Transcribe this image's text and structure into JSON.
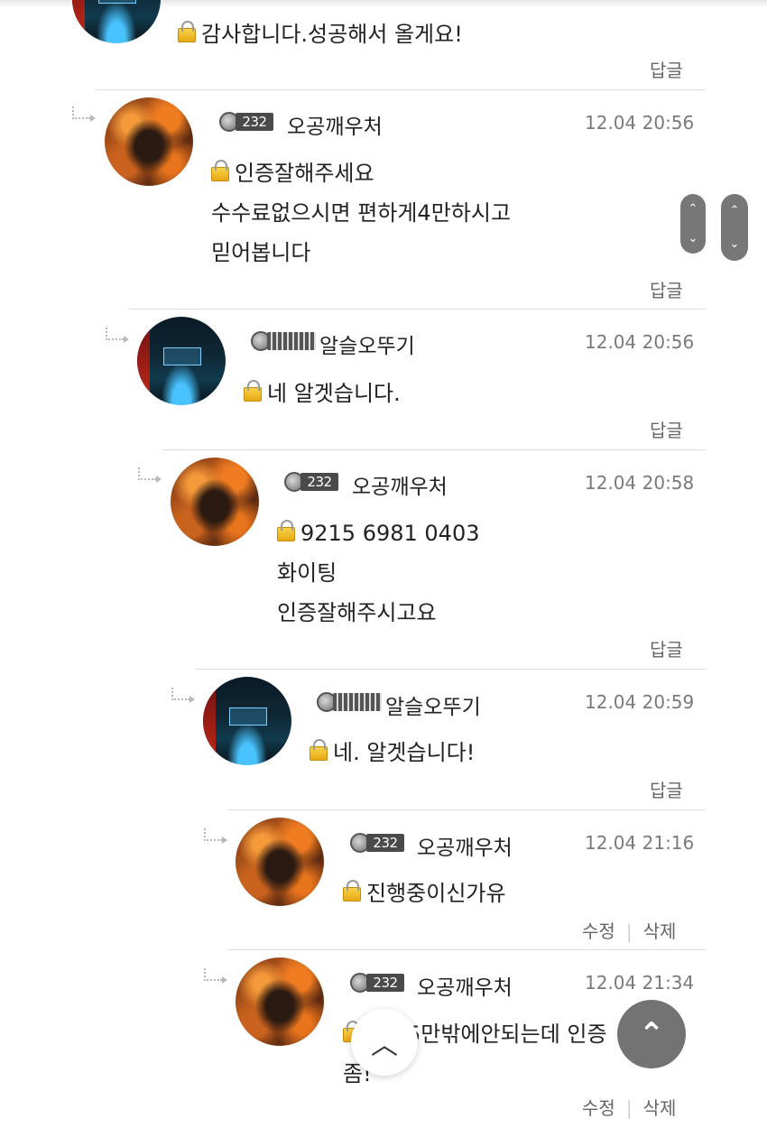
{
  "reply_label": "답글",
  "edit_label": "수정",
  "delete_label": "삭제",
  "separator": "|",
  "scroll_up_glyph": "⌃",
  "scroll_down_glyph": "⌄",
  "top_button_glyph": "︿",
  "dark_button_glyph": "⌃",
  "comments": [
    {
      "lines": [
        "감사합니다.성공해서 올게요!"
      ]
    },
    {
      "level": "232",
      "nick": "오공깨우처",
      "time": "12.04 20:56",
      "lines": [
        "인증잘해주세요",
        "수수료없으시면 편하게4만하시고",
        "믿어봅니다"
      ]
    },
    {
      "level": "",
      "nick": "알슬오뚜기",
      "time": "12.04 20:56",
      "lines": [
        "네 알겟습니다."
      ]
    },
    {
      "level": "232",
      "nick": "오공깨우처",
      "time": "12.04 20:58",
      "lines": [
        "9215 6981 0403",
        "화이팅",
        "인증잘해주시고요"
      ]
    },
    {
      "level": "",
      "nick": "알슬오뚜기",
      "time": "12.04 20:59",
      "lines": [
        "네. 알겟습니다!"
      ]
    },
    {
      "level": "232",
      "nick": "오공깨우처",
      "time": "12.04 21:16",
      "lines": [
        "진행중이신가유"
      ]
    },
    {
      "level": "232",
      "nick": "오공깨우처",
      "time": "12.04 21:34",
      "lines": [
        "우...5만밖에안되는데 인증",
        "좀!"
      ]
    }
  ]
}
